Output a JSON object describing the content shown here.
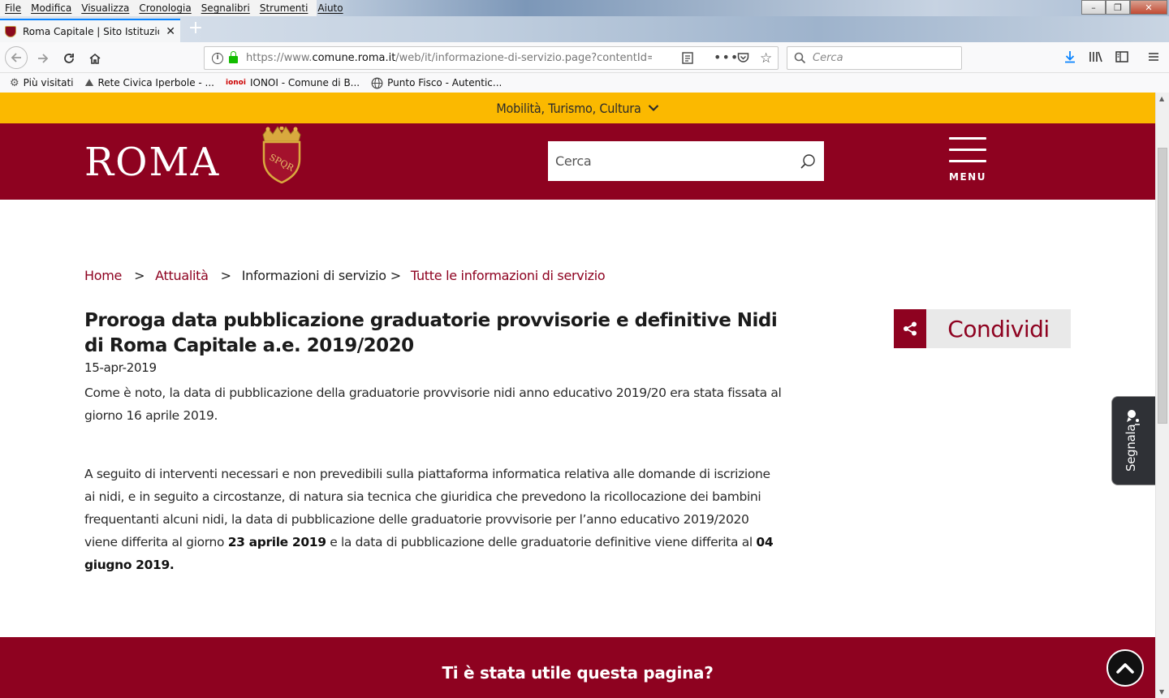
{
  "menubar": {
    "items": [
      "File",
      "Modifica",
      "Visualizza",
      "Cronologia",
      "Segnalibri",
      "Strumenti",
      "Aiuto"
    ]
  },
  "window_controls": {
    "minimize": "–",
    "maximize": "❐",
    "close": "✕"
  },
  "tab": {
    "title": "Roma Capitale | Sito Istituziona",
    "close": "✕",
    "new_tab": "+"
  },
  "navbar": {
    "url_host_prefix": "https://www.",
    "url_host": "comune.roma.it",
    "url_path": "/web/it/informazione-di-servizio.page?contentId=IDS",
    "search_placeholder": "Cerca"
  },
  "bookmarks": [
    {
      "label": "Più visitati",
      "icon": "gear-icon"
    },
    {
      "label": "Rete Civica Iperbole - ...",
      "icon": "iperbole-icon"
    },
    {
      "label": "IONOI - Comune di B...",
      "icon": "ionoi-icon"
    },
    {
      "label": "Punto Fisco - Autentic...",
      "icon": "globe-icon"
    }
  ],
  "page": {
    "topstrip": {
      "label": "Mobilità, Turismo, Cultura"
    },
    "header": {
      "logo": "ROMA",
      "crest_text": "SPQR",
      "search_placeholder": "Cerca",
      "menu_label": "MENU"
    },
    "breadcrumb": [
      {
        "label": "Home",
        "link": true
      },
      {
        "label": "Attualità",
        "link": true
      },
      {
        "label": "Informazioni di servizio",
        "link": false
      },
      {
        "label": "Tutte le informazioni di servizio",
        "link": true
      }
    ],
    "breadcrumb_sep": ">",
    "article": {
      "title": "Proroga data pubblicazione graduatorie provvisorie e definitive Nidi di Roma Capitale a.e. 2019/2020",
      "date": "15-apr-2019",
      "p1": "Come è noto, la data di pubblicazione della graduatorie provvisorie nidi anno educativo 2019/20 era stata fissata al giorno 16 aprile 2019.",
      "p2_a": "A seguito di interventi necessari e non prevedibili sulla piattaforma informatica relativa alle domande di iscrizione ai nidi, e in seguito a circostanze, di natura sia tecnica che giuridica che prevedono la ricollocazione dei bambini frequentanti alcuni nidi, la data di pubblicazione delle graduatorie provvisorie per l’anno educativo 2019/2020 viene differita al giorno ",
      "p2_b": "23 aprile 2019",
      "p2_c": " e la data di pubblicazione delle graduatorie definitive viene differita al ",
      "p2_d": "04 giugno 2019",
      "p2_e": "."
    },
    "share_label": "Condividi",
    "segnala_label": "Segnala",
    "footer_question": "Ti è stata utile questa pagina?"
  },
  "colors": {
    "brand_red": "#8e0220",
    "strip_yellow": "#fbb900",
    "firefox_blue": "#0a84ff"
  }
}
